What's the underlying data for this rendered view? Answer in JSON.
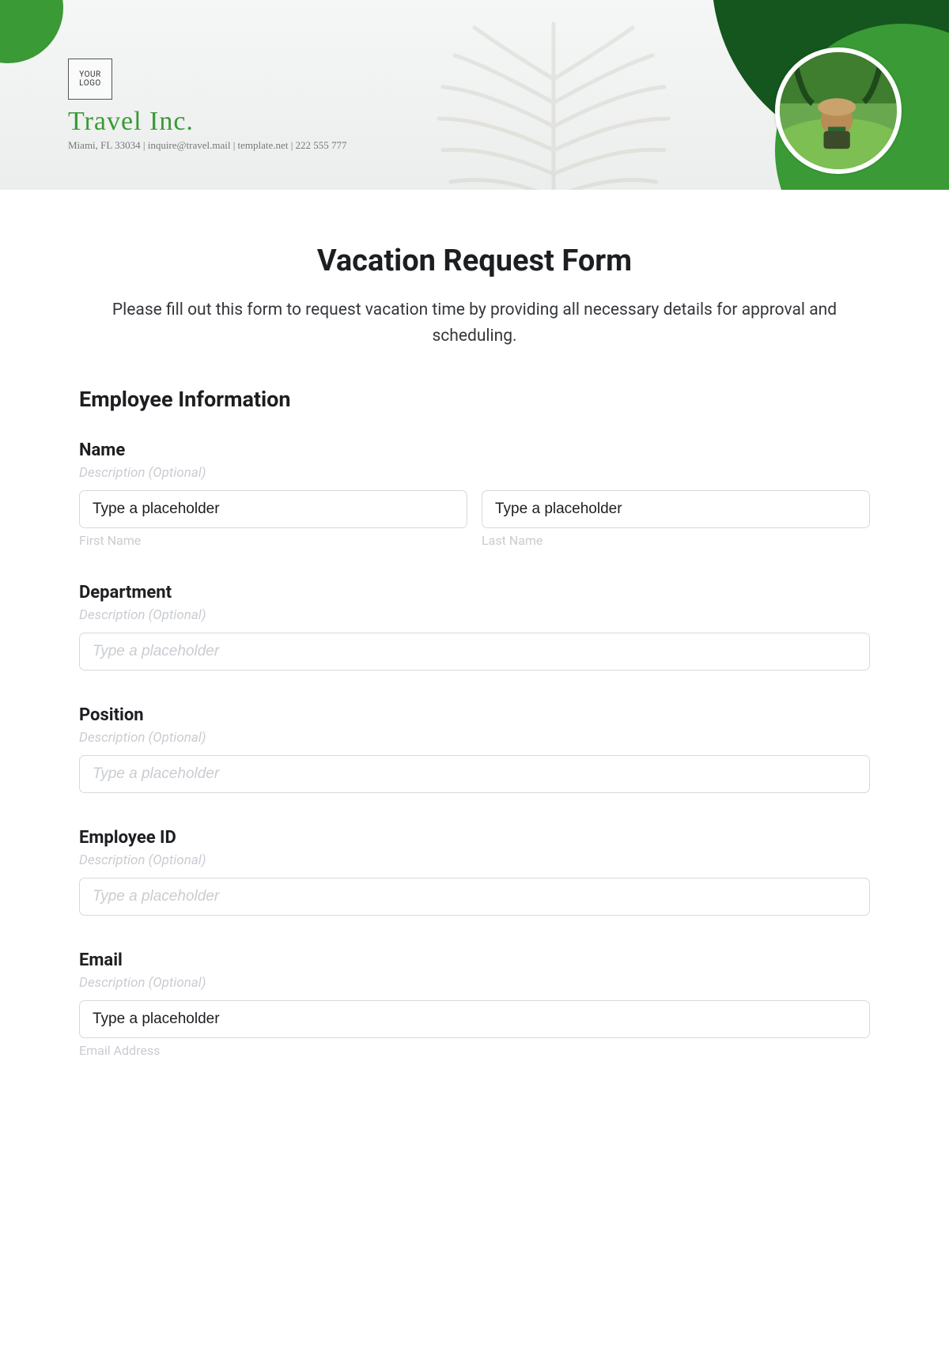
{
  "header": {
    "logo_text": "YOUR\nLOGO",
    "company_name": "Travel Inc.",
    "company_sub": "Miami, FL 33034 | inquire@travel.mail | template.net | 222 555 777"
  },
  "form": {
    "title": "Vacation Request Form",
    "intro": "Please fill out this form to request vacation time by providing all necessary details for approval and scheduling.",
    "section_heading": "Employee Information",
    "desc_placeholder": "Description (Optional)",
    "input_placeholder": "Type a placeholder",
    "fields": {
      "name": {
        "label": "Name",
        "first_sub": "First Name",
        "last_sub": "Last Name",
        "first_value": "Type a placeholder",
        "last_value": "Type a placeholder"
      },
      "department": {
        "label": "Department"
      },
      "position": {
        "label": "Position"
      },
      "employee_id": {
        "label": "Employee ID"
      },
      "email": {
        "label": "Email",
        "value": "Type a placeholder",
        "sub": "Email Address"
      }
    }
  }
}
